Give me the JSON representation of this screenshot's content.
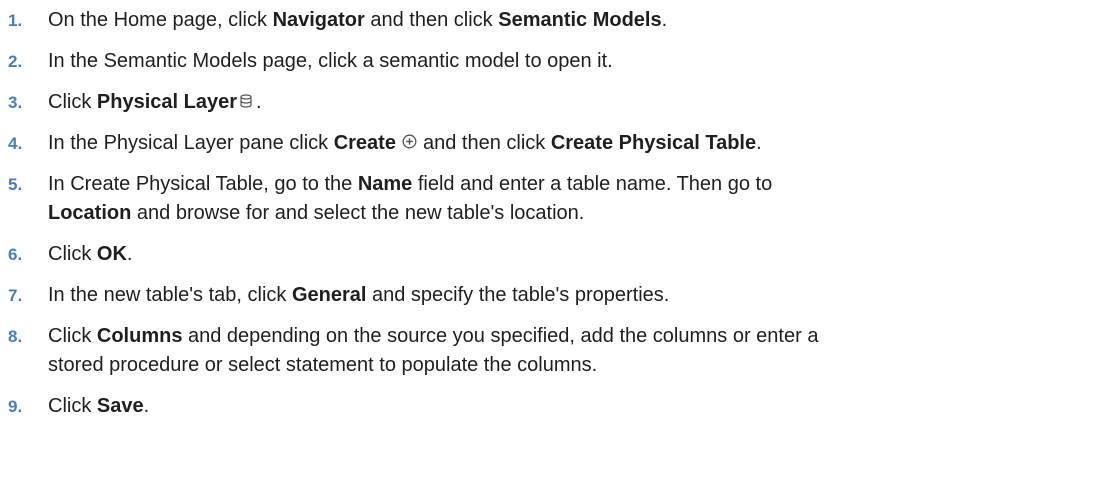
{
  "steps": [
    {
      "num": "1.",
      "parts": [
        "On the Home page, click ",
        "Navigator",
        " and then click ",
        "Semantic Models",
        "."
      ]
    },
    {
      "num": "2.",
      "parts": [
        "In the Semantic Models page, click a semantic model to open it."
      ]
    },
    {
      "num": "3.",
      "parts": [
        "Click ",
        "Physical Layer",
        "."
      ],
      "icon": "database-icon"
    },
    {
      "num": "4.",
      "parts": [
        "In the Physical Layer pane click ",
        "Create",
        "and then click ",
        "Create Physical Table",
        "."
      ],
      "icon": "plus-circle-icon"
    },
    {
      "num": "5.",
      "lines": [
        "In Create Physical Table, go to the ",
        "Name",
        " field and enter a table name. Then go to",
        "Location",
        " and browse for and select the new table's location."
      ]
    },
    {
      "num": "6.",
      "parts": [
        "Click ",
        "OK",
        "."
      ]
    },
    {
      "num": "7.",
      "parts": [
        "In the new table's tab, click ",
        "General",
        " and specify the table's properties."
      ]
    },
    {
      "num": "8.",
      "lines": [
        "Click ",
        "Columns",
        " and depending on the source you specified, add the columns or enter a",
        "stored procedure or select statement to populate the columns."
      ]
    },
    {
      "num": "9.",
      "parts": [
        "Click ",
        "Save",
        "."
      ]
    }
  ]
}
